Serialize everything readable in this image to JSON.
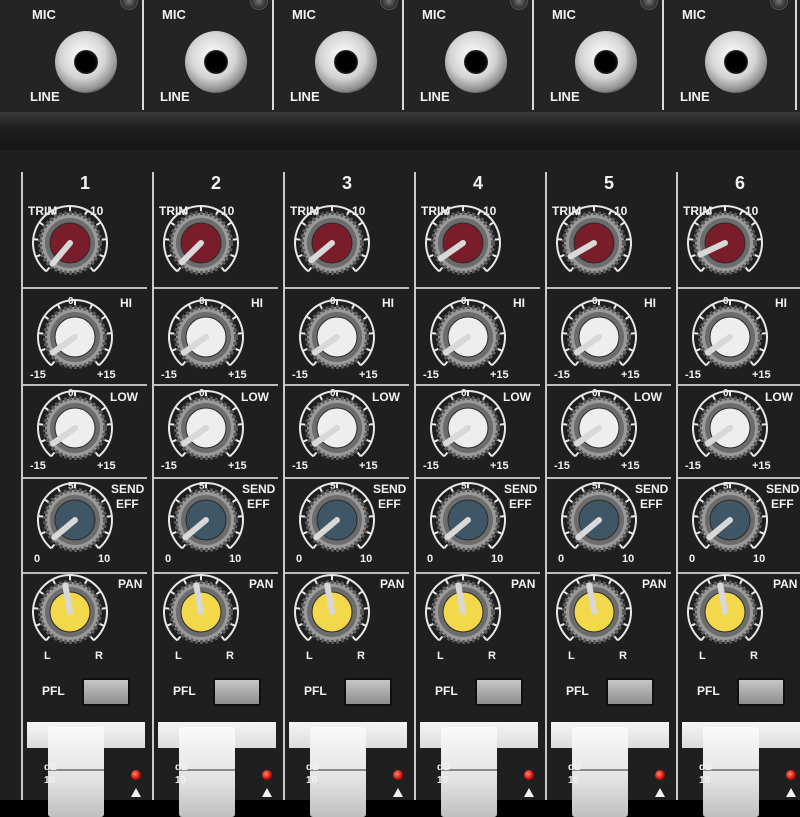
{
  "input_row": {
    "mic_label": "MIC",
    "line_label": "LINE"
  },
  "labels": {
    "trim": "TRIM",
    "trim_value": "-10",
    "hi": "HI",
    "low": "LOW",
    "zero": "0",
    "min_eq": "-15",
    "max_eq": "+15",
    "send": "SEND",
    "eff": "EFF",
    "send_zero": "0",
    "send_mid": "5",
    "send_max": "10",
    "pan": "PAN",
    "left": "L",
    "right": "R",
    "pfl": "PFL",
    "db": "dB",
    "ten": "10"
  },
  "channels": [
    {
      "number": "1"
    },
    {
      "number": "2"
    },
    {
      "number": "3"
    },
    {
      "number": "4"
    },
    {
      "number": "5"
    },
    {
      "number": "6"
    }
  ],
  "colors": {
    "trim_knob": "#7a1d2b",
    "eq_knob": "#eeeeee",
    "send_knob": "#3f5666",
    "pan_knob": "#f2d84a",
    "panel": "#1f1f1f",
    "print": "#f2f2f2"
  },
  "icons": [
    "jack-socket-icon",
    "screw-icon",
    "peak-led-icon",
    "triangle-marker-icon"
  ]
}
